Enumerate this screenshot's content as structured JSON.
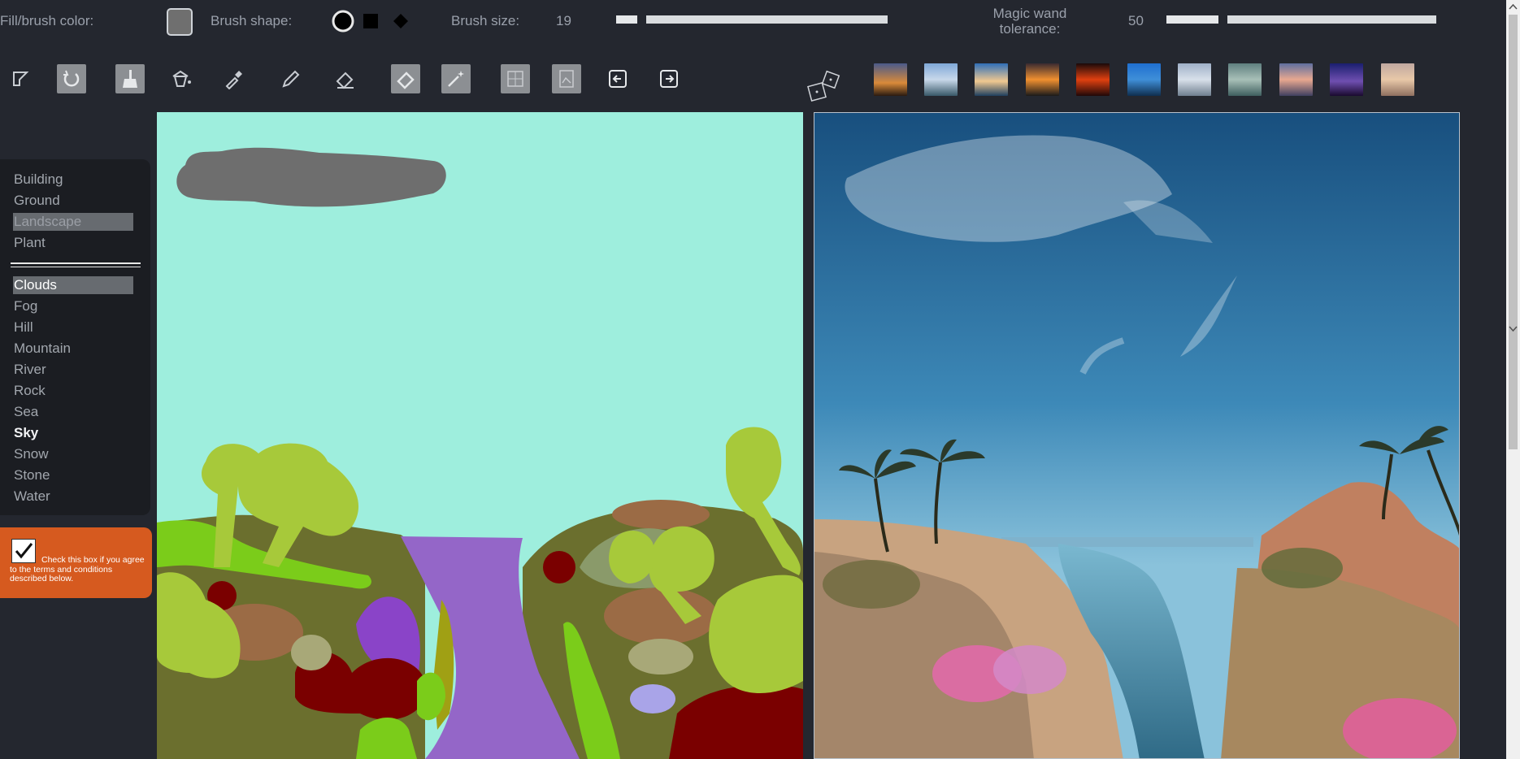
{
  "topbar": {
    "fill_label": "Fill/brush color:",
    "fill_color": "#6f6f6f",
    "shape_label": "Brush shape:",
    "shapes": [
      "circle-icon",
      "square-icon",
      "diamond-icon"
    ],
    "size_label": "Brush size:",
    "size_value": "19",
    "wand_label_1": "Magic wand",
    "wand_label_2": "tolerance:",
    "wand_value": "50"
  },
  "toolbar": {
    "tools": [
      "selection-icon",
      "undo-icon",
      "broom-icon",
      "bucket-icon",
      "eyedropper-icon",
      "pencil-icon",
      "eraser-icon",
      "eraser-block-icon",
      "magic-wand-icon",
      "grid-icon",
      "image-icon",
      "left-arrow-icon",
      "right-arrow-icon"
    ],
    "dice_icon": "dice-icon"
  },
  "thumbnails": [
    "thumb-sunset-dunes",
    "thumb-lake",
    "thumb-sea-dusk",
    "thumb-sunset-sea",
    "thumb-red-sun",
    "thumb-blue-water",
    "thumb-cloudy-sky",
    "thumb-foggy-coast",
    "thumb-pink-sky",
    "thumb-night-city",
    "thumb-peach-dusk"
  ],
  "categories": {
    "group1": [
      "Building",
      "Ground",
      "Landscape",
      "Plant"
    ],
    "group2": [
      "Clouds",
      "Fog",
      "Hill",
      "Mountain",
      "River",
      "Rock",
      "Sea",
      "Sky",
      "Snow",
      "Stone",
      "Water"
    ]
  },
  "terms": {
    "checked": true,
    "text": "Check this box if you agree to the terms and conditions described below."
  }
}
